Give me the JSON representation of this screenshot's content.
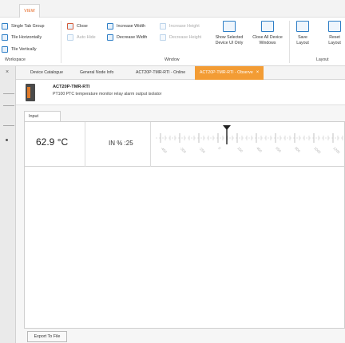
{
  "ribbon": {
    "view_tab": "VIEW",
    "workspace": {
      "label": "Workspace",
      "items": [
        "Single Tab Group",
        "Tile Horizontally",
        "Tile Vertically"
      ]
    },
    "window": {
      "label": "Window",
      "close": "Close",
      "auto_hide": "Auto Hide",
      "increase_width": "Increase Width",
      "decrease_width": "Decrease Width",
      "increase_height": "Increase Height",
      "decrease_height": "Decrease Height",
      "show_selected": "Show Selected\nDevice UI Only",
      "close_all": "Close All Device\nWindows"
    },
    "layout": {
      "label": "Layout",
      "save": "Save\nLayout",
      "reset": "Reset\nLayout"
    }
  },
  "doc_tabs": [
    {
      "label": "Device Catalogue",
      "active": false
    },
    {
      "label": "General Node Info",
      "active": false
    },
    {
      "label": "ACT20P-TMR-RTI - Online",
      "active": false
    },
    {
      "label": "ACT20P-TMR-RTI - Observe",
      "active": true
    }
  ],
  "device": {
    "name": "ACT20P-TMR-RTI",
    "description": "PT100 PTC temperature monitor relay alarm output isolator"
  },
  "content": {
    "input_tab": "Input",
    "temperature": "62.9 °C",
    "in_percent": "IN % :25",
    "scale_ticks": [
      "-450",
      "-300",
      "-250",
      "0",
      "150",
      "400",
      "650",
      "800",
      "1000",
      "1200"
    ],
    "export_button": "Export To File"
  },
  "colors": {
    "accent": "#f39c34",
    "view_tab_text": "#e35a10",
    "ribbon_icon": "#2d7ec6"
  }
}
